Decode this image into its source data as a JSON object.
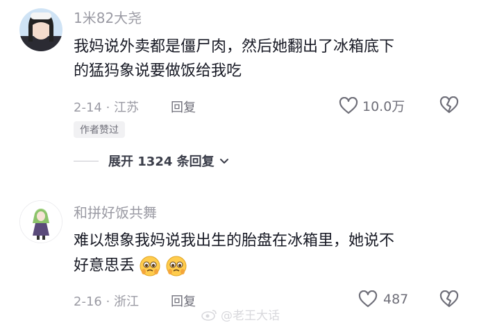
{
  "comments": [
    {
      "username": "1米82大尧",
      "text_line1": "我妈说外卖都是僵尸肉，然后她翻出了冰箱底下",
      "text_line2": "的猛犸象说要做饭给我吃",
      "date_location": "2-14 · 江苏",
      "reply_label": "回复",
      "likes": "10.0万",
      "author_badge": "作者赞过",
      "expand_label": "展开 1324 条回复"
    },
    {
      "username": "和拼好饭共舞",
      "text_line1": "难以想象我妈说我出生的胎盘在冰箱里，她说不",
      "text_line2": "好意思丢",
      "date_location": "2-16 · 浙江",
      "reply_label": "回复",
      "likes": "487"
    }
  ],
  "watermark": "@老王大话",
  "icons": {
    "like": "heart-outline-icon",
    "dislike": "broken-heart-icon",
    "expand": "chevron-down-icon",
    "emoji": "pleading-face-emoji"
  }
}
